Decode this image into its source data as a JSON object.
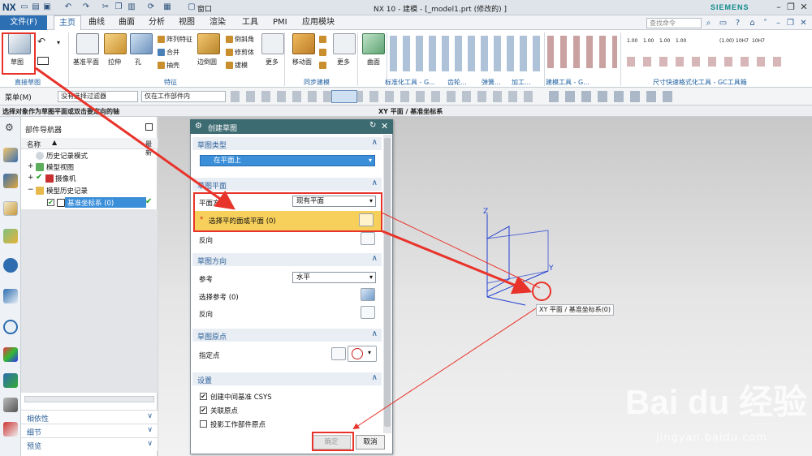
{
  "app": {
    "logo": "NX",
    "window_title": "NX 10 - 建模 - [_model1.prt  (修改的) ]",
    "brand": "SIEMENS",
    "window_menu": "窗口"
  },
  "menu": {
    "file": "文件(F)",
    "tabs": [
      "主页",
      "曲线",
      "曲面",
      "分析",
      "视图",
      "渲染",
      "工具",
      "PMI",
      "应用模块"
    ],
    "active_tab": "主页",
    "search_placeholder": "查找命令"
  },
  "ribbon": {
    "sketch": "草图",
    "datum_plane": "基准平面",
    "extrude": "拉伸",
    "hole": "孔",
    "pattern_feature": "阵列特征",
    "unite": "合并",
    "shell": "抽壳",
    "edge_blend": "边倒圆",
    "chamfer": "倒斜角",
    "trim_body": "修剪体",
    "draft": "拔模",
    "more": "更多",
    "move_face": "移动面",
    "surface": "曲面",
    "groups": {
      "direct_sketch": "直接草图",
      "feature": "特征",
      "sync_modeling": "同步建模",
      "standard_parts": "标准化工具 - G...",
      "gear": "齿轮...",
      "spring": "弹簧...",
      "machining": "加工...",
      "modeling_tools": "建模工具 - G...",
      "dimension_tools": "尺寸快速格式化工具 - GC工具箱"
    },
    "dim_labels": [
      "1.00",
      "1.00",
      "1.00",
      "1.00",
      "(1.00)",
      "10H7",
      "10H7"
    ]
  },
  "filterbar": {
    "menu": "菜单(M)",
    "filter": "没有选择过滤器",
    "scope": "仅在工作部件内"
  },
  "status": {
    "prompt": "选择对象作为草图平面或双击要定向的轴",
    "selection": "XY 平面 / 基准坐标系"
  },
  "navigator": {
    "title": "部件导航器",
    "col_name": "名称",
    "col_latest": "最新",
    "items": [
      {
        "label": "历史记录模式"
      },
      {
        "label": "模型视图"
      },
      {
        "label": "摄像机"
      },
      {
        "label": "模型历史记录"
      },
      {
        "label": "基准坐标系 (0)"
      }
    ],
    "panels": [
      "相依性",
      "细节",
      "预览"
    ]
  },
  "dialog": {
    "title": "创建草图",
    "sections": {
      "type": "草图类型",
      "plane": "草图平面",
      "orientation": "草图方向",
      "origin": "草图原点",
      "settings": "设置"
    },
    "type_value": "在平面上",
    "plane_method_label": "平面方法",
    "plane_method_value": "现有平面",
    "select_plane": "选择平的面或平面 (0)",
    "reverse": "反向",
    "reference_label": "参考",
    "reference_value": "水平",
    "select_reference": "选择参考 (0)",
    "reverse2": "反向",
    "specify_point": "指定点",
    "settings": [
      {
        "label": "创建中间基准 CSYS",
        "checked": true
      },
      {
        "label": "关联原点",
        "checked": true
      },
      {
        "label": "投影工作部件原点",
        "checked": false
      }
    ],
    "ok": "确定",
    "cancel": "取消"
  },
  "viewport": {
    "csys_label": "XY 平面 / 基准坐标系(0)",
    "axis_z": "Z",
    "axis_y": "Y",
    "axis_x": "X",
    "watermark": "Bai du 经验",
    "watermark_url": "jingyan.baidu.com"
  },
  "colors": {
    "accent": "#2c6fb3",
    "dialog_title": "#3d6b72",
    "highlight": "#f7d05c",
    "annotation": "#e8332a",
    "axis": "#1f3fd1"
  }
}
